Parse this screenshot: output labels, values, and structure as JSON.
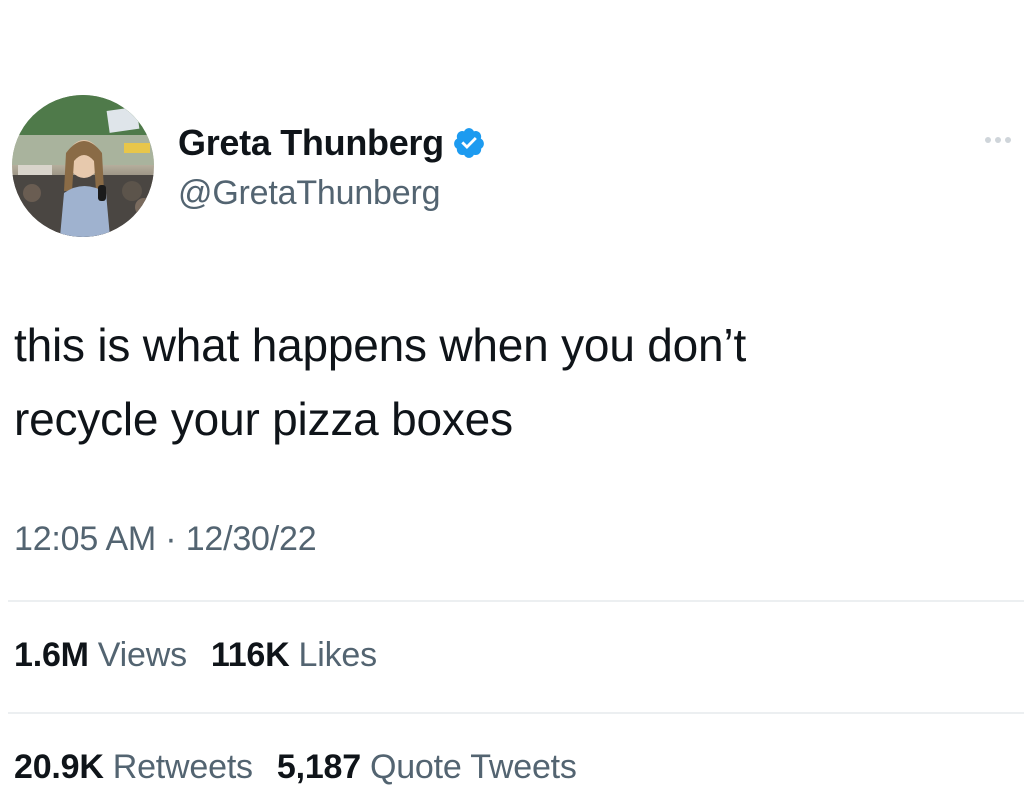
{
  "author": {
    "display_name": "Greta Thunberg",
    "handle": "@GretaThunberg",
    "verified": true,
    "verified_color": "#1d9bf0",
    "avatar_icon": "profile-photo"
  },
  "more_icon": "more-options-dots-icon",
  "tweet": {
    "lines": [
      "this is what happens when you don’t",
      "recycle your pizza boxes"
    ]
  },
  "meta": {
    "time": "12:05 AM",
    "separator": " · ",
    "date": "12/30/22"
  },
  "stats": {
    "views": {
      "count": "1.6M",
      "label": "Views"
    },
    "likes": {
      "count": "116K",
      "label": "Likes"
    },
    "retweets": {
      "count": "20.9K",
      "label": "Retweets"
    },
    "quotes": {
      "count": "5,187",
      "label": "Quote Tweets"
    }
  },
  "colors": {
    "text_primary": "#0f1419",
    "text_secondary": "#536471",
    "divider": "#eceff1"
  }
}
